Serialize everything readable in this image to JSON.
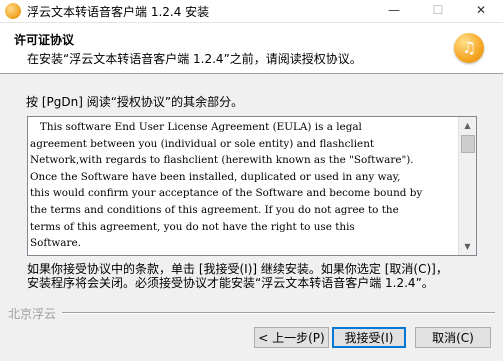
{
  "window": {
    "title": "浮云文本转语音客户端 1.2.4 安装",
    "minimize_glyph": "—",
    "maximize_glyph": "☐",
    "close_glyph": "✕"
  },
  "header": {
    "title": "许可证协议",
    "subtitle": "在安装“浮云文本转语音客户端 1.2.4”之前，请阅读授权协议。",
    "logo_glyph": "♫",
    "logo_icon": "music-note-icon"
  },
  "instruction": "按 [PgDn] 阅读“授权协议”的其余部分。",
  "license": {
    "lines": [
      "   This software End User License Agreement (EULA) is a legal",
      "agreement between you (individual or sole entity) and flashclient",
      "Network,with regards to flashclient (herewith known as the \"Software\").",
      "Once the Software have been installed, duplicated or used in any way,",
      "this would confirm your acceptance of the Software and become bound by",
      "the terms and conditions of this agreement. If you do not agree to the",
      "terms of this agreement, you do not have the right to use this",
      "Software."
    ],
    "scroll_up_glyph": "▲",
    "scroll_down_glyph": "▼"
  },
  "notice": {
    "line1": "如果你接受协议中的条款，单击 [我接受(I)] 继续安装。如果你选定 [取消(C)]，",
    "line2": "安装程序将会关闭。必须接受协议才能安装“浮云文本转语音客户端 1.2.4”。"
  },
  "brand": "北京浮云",
  "buttons": {
    "back": "< 上一步(P)",
    "accept": "我接受(I)",
    "cancel": "取消(C)"
  }
}
